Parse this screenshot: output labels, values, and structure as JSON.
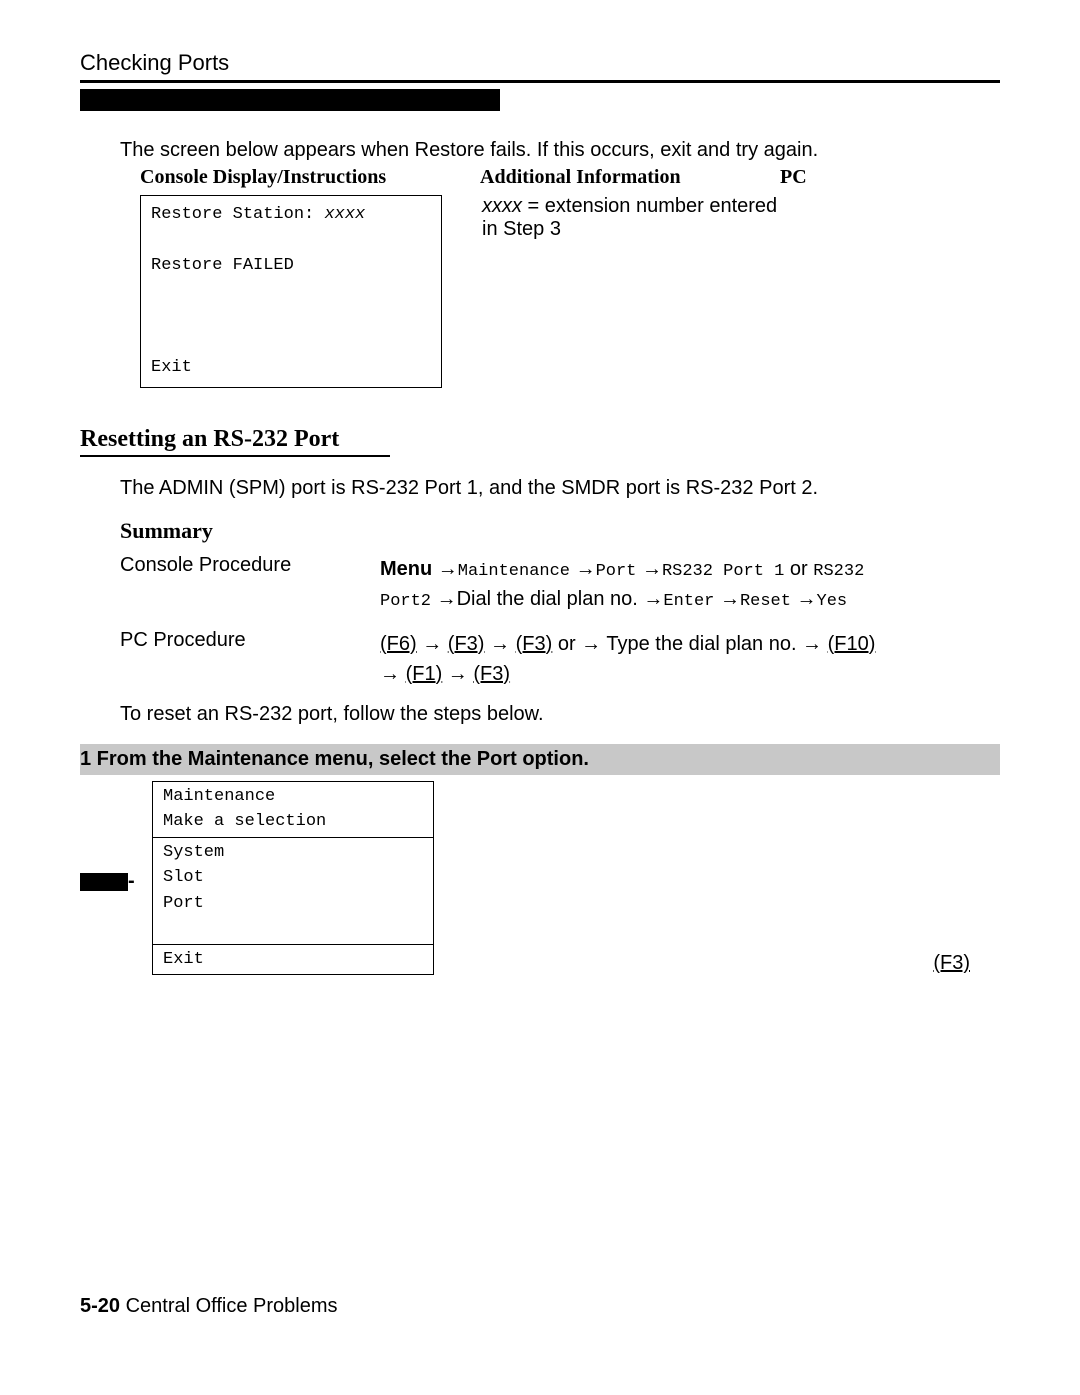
{
  "header": {
    "section": "Checking Ports"
  },
  "intro_text": "The screen below appears when Restore fails. If this occurs, exit and try again.",
  "col_headers": {
    "display": "Console Display/Instructions",
    "info": "Additional Information",
    "pc": "PC"
  },
  "console1": {
    "line1a": "Restore Station: ",
    "line1b": "xxxx",
    "line2": "Restore FAILED",
    "exit": "Exit"
  },
  "info1": {
    "xxxx": "xxxx",
    "rest": " = extension number entered",
    "line2": "in Step 3"
  },
  "resetting_heading": "Resetting an RS-232 Port",
  "admin_text": "The ADMIN (SPM) port is RS-232 Port 1, and the SMDR port is RS-232 Port 2.",
  "summary_heading": "Summary",
  "console_proc": {
    "label": "Console Procedure",
    "menu_bold": "Menu",
    "arrow": " →",
    "m1": "Maintenance",
    "m2": "Port",
    "m3": "RS232 Port 1",
    "or": " or ",
    "m3b": "RS232",
    "line2a": "Port2",
    "dial": "Dial the dial plan no.",
    "enter": "Enter",
    "reset": "Reset",
    "yes": "Yes"
  },
  "pc_proc": {
    "label": "PC Procedure",
    "f6": "(F6)",
    "f3": "(F3)",
    "type": "Type the dial plan no.",
    "f10": "(F10)",
    "f1": "(F1)",
    "or": " or → "
  },
  "reset_text": "To reset an RS-232 port, follow the steps below.",
  "step1": {
    "title": "1 From the Maintenance menu, select the Port option.",
    "l1": "Maintenance",
    "l2": "Make a selection",
    "l3": "System",
    "l4": "Slot",
    "l5": "Port",
    "exit": "Exit",
    "fkey": "(F3)"
  },
  "footer": {
    "page": "5-20",
    "text": " Central Office Problems"
  }
}
